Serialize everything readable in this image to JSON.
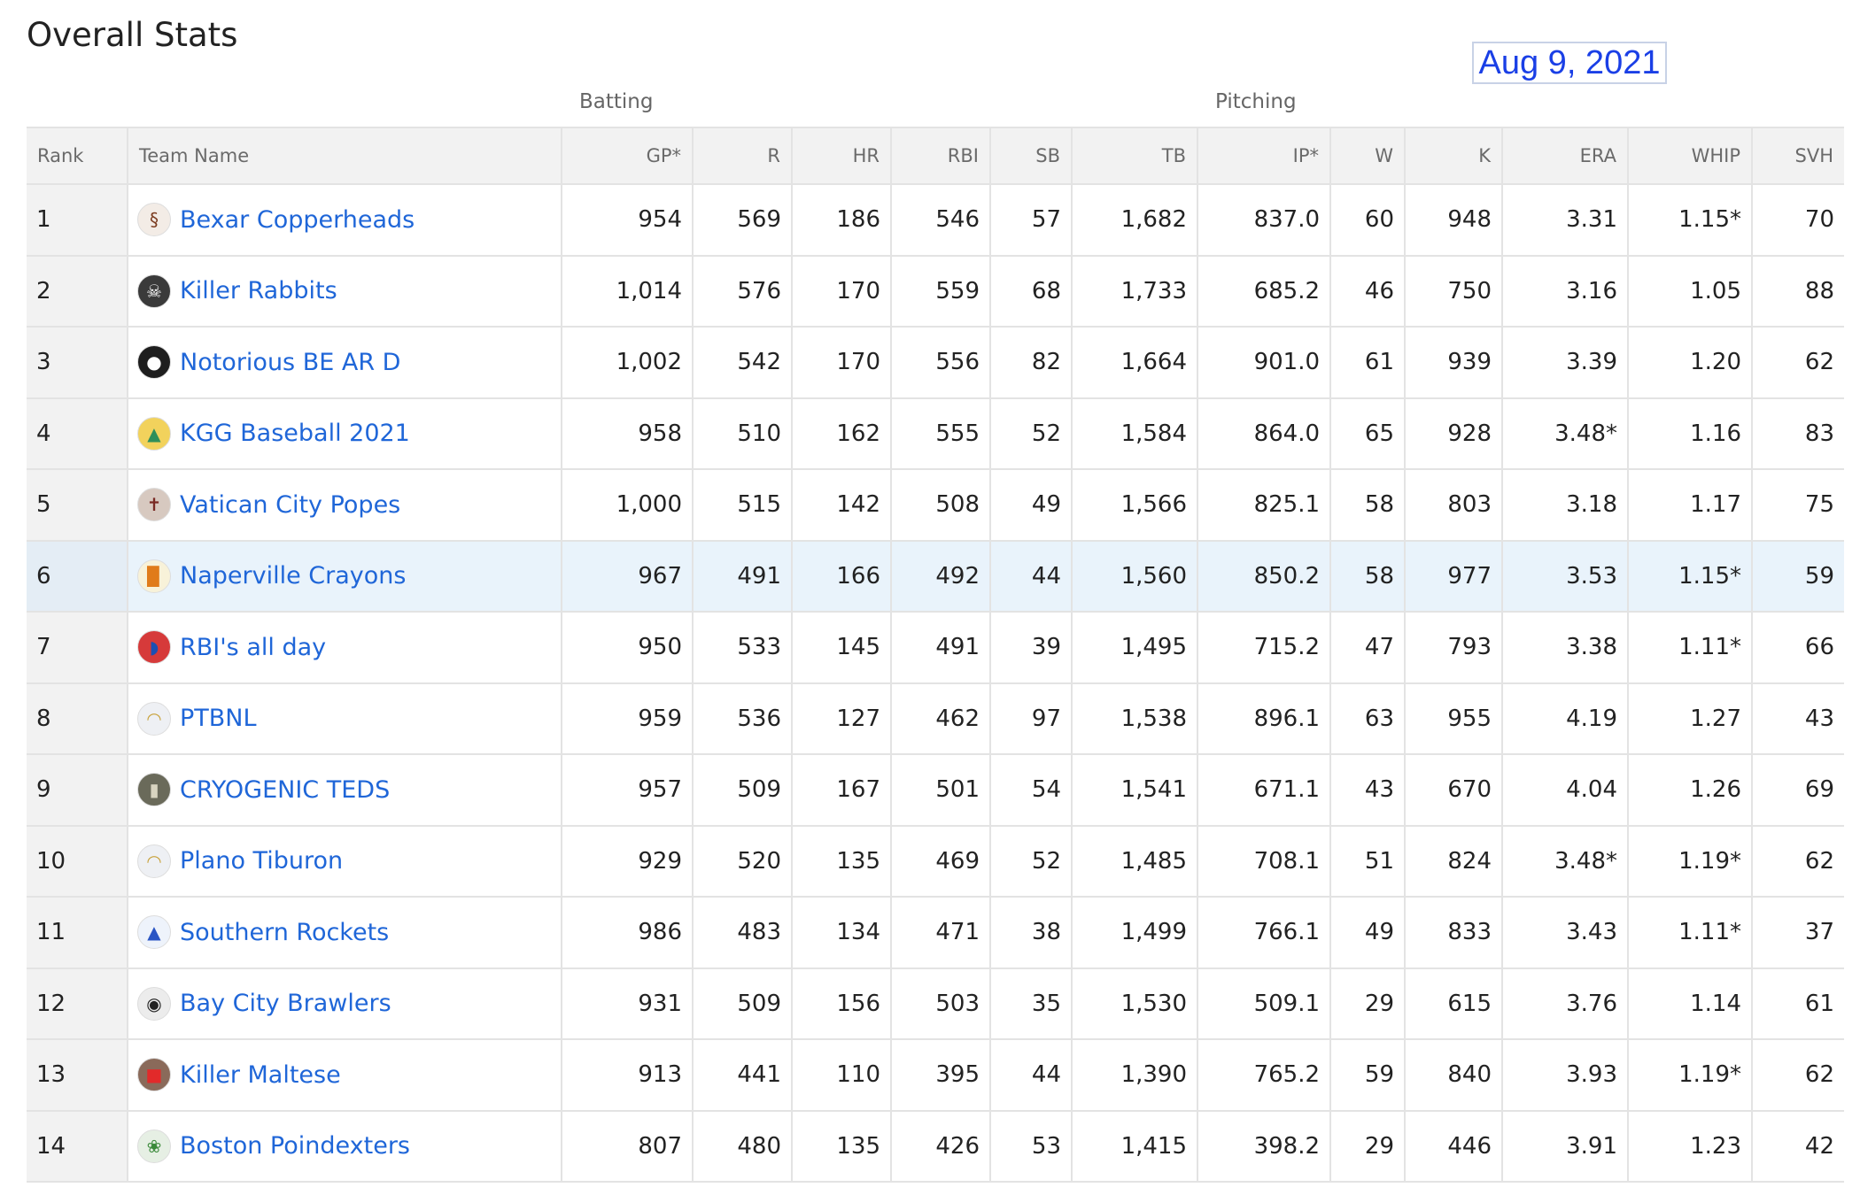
{
  "page": {
    "title": "Overall Stats",
    "date": "Aug 9, 2021"
  },
  "groups": {
    "batting": "Batting",
    "pitching": "Pitching"
  },
  "columns": [
    "Rank",
    "Team Name",
    "GP*",
    "R",
    "HR",
    "RBI",
    "SB",
    "TB",
    "IP*",
    "W",
    "K",
    "ERA",
    "WHIP",
    "SVH"
  ],
  "colors": {
    "link": "#1f66d8",
    "highlight_row": "#e9f3fb",
    "header_bg": "#f2f2f2",
    "date_text": "#1a3fe6"
  },
  "rows": [
    {
      "rank": "1",
      "team": "Bexar Copperheads",
      "logo": "snake-logo-icon",
      "gp": "954",
      "r": "569",
      "hr": "186",
      "rbi": "546",
      "sb": "57",
      "tb": "1,682",
      "ip": "837.0",
      "w": "60",
      "k": "948",
      "era": "3.31",
      "whip": "1.15*",
      "svh": "70"
    },
    {
      "rank": "2",
      "team": "Killer Rabbits",
      "logo": "rabbit-logo-icon",
      "gp": "1,014",
      "r": "576",
      "hr": "170",
      "rbi": "559",
      "sb": "68",
      "tb": "1,733",
      "ip": "685.2",
      "w": "46",
      "k": "750",
      "era": "3.16",
      "whip": "1.05",
      "svh": "88"
    },
    {
      "rank": "3",
      "team": "Notorious BE AR D",
      "logo": "bear-logo-icon",
      "gp": "1,002",
      "r": "542",
      "hr": "170",
      "rbi": "556",
      "sb": "82",
      "tb": "1,664",
      "ip": "901.0",
      "w": "61",
      "k": "939",
      "era": "3.39",
      "whip": "1.20",
      "svh": "62"
    },
    {
      "rank": "4",
      "team": "KGG Baseball 2021",
      "logo": "cap-logo-icon",
      "gp": "958",
      "r": "510",
      "hr": "162",
      "rbi": "555",
      "sb": "52",
      "tb": "1,584",
      "ip": "864.0",
      "w": "65",
      "k": "928",
      "era": "3.48*",
      "whip": "1.16",
      "svh": "83"
    },
    {
      "rank": "5",
      "team": "Vatican City Popes",
      "logo": "pope-logo-icon",
      "gp": "1,000",
      "r": "515",
      "hr": "142",
      "rbi": "508",
      "sb": "49",
      "tb": "1,566",
      "ip": "825.1",
      "w": "58",
      "k": "803",
      "era": "3.18",
      "whip": "1.17",
      "svh": "75"
    },
    {
      "rank": "6",
      "team": "Naperville Crayons",
      "logo": "crayon-logo-icon",
      "gp": "967",
      "r": "491",
      "hr": "166",
      "rbi": "492",
      "sb": "44",
      "tb": "1,560",
      "ip": "850.2",
      "w": "58",
      "k": "977",
      "era": "3.53",
      "whip": "1.15*",
      "svh": "59",
      "highlight": true
    },
    {
      "rank": "7",
      "team": "RBI's all day",
      "logo": "helmet-logo-icon",
      "gp": "950",
      "r": "533",
      "hr": "145",
      "rbi": "491",
      "sb": "39",
      "tb": "1,495",
      "ip": "715.2",
      "w": "47",
      "k": "793",
      "era": "3.38",
      "whip": "1.11*",
      "svh": "66"
    },
    {
      "rank": "8",
      "team": "PTBNL",
      "logo": "default-cap-logo-icon",
      "gp": "959",
      "r": "536",
      "hr": "127",
      "rbi": "462",
      "sb": "97",
      "tb": "1,538",
      "ip": "896.1",
      "w": "63",
      "k": "955",
      "era": "4.19",
      "whip": "1.27",
      "svh": "43"
    },
    {
      "rank": "9",
      "team": "CRYOGENIC TEDS",
      "logo": "canister-logo-icon",
      "gp": "957",
      "r": "509",
      "hr": "167",
      "rbi": "501",
      "sb": "54",
      "tb": "1,541",
      "ip": "671.1",
      "w": "43",
      "k": "670",
      "era": "4.04",
      "whip": "1.26",
      "svh": "69"
    },
    {
      "rank": "10",
      "team": "Plano Tiburon",
      "logo": "default-cap-logo-icon",
      "gp": "929",
      "r": "520",
      "hr": "135",
      "rbi": "469",
      "sb": "52",
      "tb": "1,485",
      "ip": "708.1",
      "w": "51",
      "k": "824",
      "era": "3.48*",
      "whip": "1.19*",
      "svh": "62"
    },
    {
      "rank": "11",
      "team": "Southern Rockets",
      "logo": "rocket-logo-icon",
      "gp": "986",
      "r": "483",
      "hr": "134",
      "rbi": "471",
      "sb": "38",
      "tb": "1,499",
      "ip": "766.1",
      "w": "49",
      "k": "833",
      "era": "3.43",
      "whip": "1.11*",
      "svh": "37"
    },
    {
      "rank": "12",
      "team": "Bay City Brawlers",
      "logo": "dog-logo-icon",
      "gp": "931",
      "r": "509",
      "hr": "156",
      "rbi": "503",
      "sb": "35",
      "tb": "1,530",
      "ip": "509.1",
      "w": "29",
      "k": "615",
      "era": "3.76",
      "whip": "1.14",
      "svh": "61"
    },
    {
      "rank": "13",
      "team": "Killer Maltese",
      "logo": "maltese-logo-icon",
      "gp": "913",
      "r": "441",
      "hr": "110",
      "rbi": "395",
      "sb": "44",
      "tb": "1,390",
      "ip": "765.2",
      "w": "59",
      "k": "840",
      "era": "3.93",
      "whip": "1.19*",
      "svh": "62"
    },
    {
      "rank": "14",
      "team": "Boston Poindexters",
      "logo": "frog-logo-icon",
      "gp": "807",
      "r": "480",
      "hr": "135",
      "rbi": "426",
      "sb": "53",
      "tb": "1,415",
      "ip": "398.2",
      "w": "29",
      "k": "446",
      "era": "3.91",
      "whip": "1.23",
      "svh": "42"
    }
  ]
}
